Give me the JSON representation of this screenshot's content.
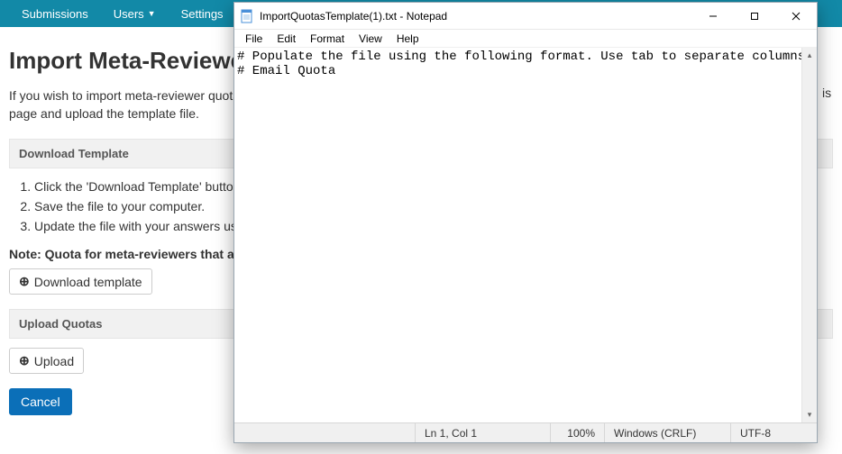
{
  "nav": {
    "submissions": "Submissions",
    "users": "Users",
    "settings": "Settings"
  },
  "page": {
    "title_visible": "Import Meta-Reviewer Q",
    "intro_line1": "If you wish to import meta-reviewer quotas,",
    "intro_line2": "page and upload the template file.",
    "right_clip": "is",
    "download_header": "Download Template",
    "steps": [
      "Click the 'Download Template' button.",
      "Save the file to your computer.",
      "Update the file with your answers using"
    ],
    "note_visible": "Note: Quota for meta-reviewers that are",
    "btn_download": "Download template",
    "btn_download_icon": "⊕",
    "upload_header": "Upload Quotas",
    "btn_upload": "Upload",
    "btn_upload_icon": "⊕",
    "btn_cancel": "Cancel"
  },
  "notepad": {
    "title": "ImportQuotasTemplate(1).txt - Notepad",
    "menu": {
      "file": "File",
      "edit": "Edit",
      "format": "Format",
      "view": "View",
      "help": "Help"
    },
    "content": "# Populate the file using the following format. Use tab to separate columns.\n# Email Quota",
    "status": {
      "position": "Ln 1, Col 1",
      "zoom": "100%",
      "eol": "Windows (CRLF)",
      "encoding": "UTF-8"
    }
  }
}
